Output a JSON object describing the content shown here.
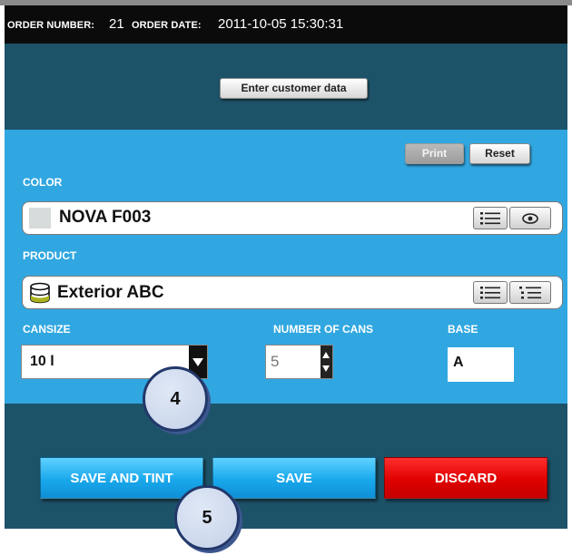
{
  "header": {
    "order_number_label": "ORDER NUMBER:",
    "order_number": "21",
    "order_date_label": "ORDER DATE:",
    "order_date": "2011-10-05 15:30:31"
  },
  "buttons": {
    "enter_customer_data": "Enter customer data",
    "print": "Print",
    "reset": "Reset",
    "save_and_tint": "SAVE AND TINT",
    "save": "SAVE",
    "discard": "DISCARD"
  },
  "color": {
    "label": "COLOR",
    "value": "NOVA F003",
    "swatch": "#d8dbdc"
  },
  "product": {
    "label": "PRODUCT",
    "value": "Exterior ABC",
    "icon": "paint-can-icon"
  },
  "cansize": {
    "label": "CANSIZE",
    "value": "10 l"
  },
  "number_of_cans": {
    "label": "NUMBER OF CANS",
    "value": "5"
  },
  "base": {
    "label": "BASE",
    "value": "A"
  },
  "callouts": {
    "cansize_step": "4",
    "save_and_tint_step": "5"
  },
  "colors": {
    "panel_dark": "#1d5369",
    "panel_light": "#31a7e1",
    "header": "#0b0b0b",
    "blue_button": "#19a8ec",
    "red_button": "#e00000"
  }
}
